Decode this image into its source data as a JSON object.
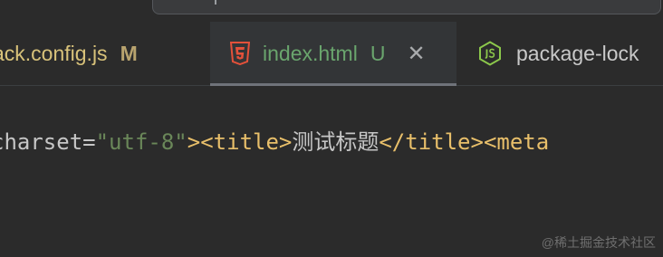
{
  "tabs": [
    {
      "name": "ack.config.js",
      "status": "M",
      "icon": "none",
      "active": false
    },
    {
      "name": "index.html",
      "status": "U",
      "icon": "html5-icon",
      "active": true
    },
    {
      "name": "package-lock",
      "status": "",
      "icon": "nodejs-icon",
      "active": false
    }
  ],
  "code": {
    "attr": "charset",
    "equals": "=",
    "value": "\"utf-8\"",
    "open_title": "><title>",
    "title_text": "测试标题",
    "close_title": "</title>",
    "meta": "<meta"
  },
  "watermark": "@稀土掘金技术社区",
  "colors": {
    "background": "#2b2b2b",
    "active_tab": "#333537",
    "modified": "#d8c27a",
    "untracked": "#6aa56d",
    "tag": "#e8bf6a",
    "string": "#6a8759"
  }
}
